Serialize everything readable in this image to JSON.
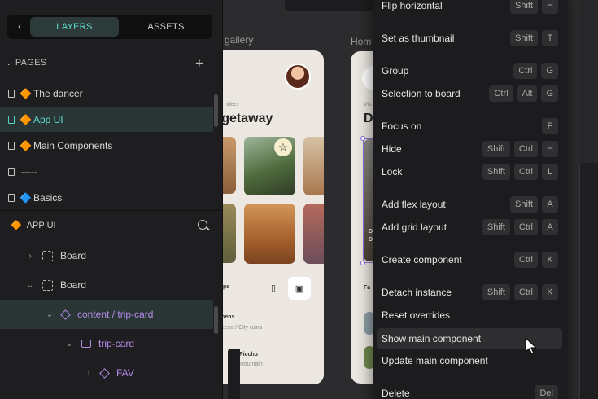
{
  "sidebar": {
    "tabs": {
      "back_icon": "chevron-left-icon",
      "layers": "LAYERS",
      "assets": "ASSETS"
    },
    "pages": {
      "header": "PAGES",
      "items": [
        {
          "label": "The dancer",
          "emoji": "🔶"
        },
        {
          "label": "App UI",
          "emoji": "🔶"
        },
        {
          "label": "Main Components",
          "emoji": "🔶"
        },
        {
          "label": "-----",
          "emoji": ""
        },
        {
          "label": "Basics",
          "emoji": "🔷"
        }
      ]
    },
    "layers": {
      "header": "APP UI",
      "header_emoji": "🔶",
      "items": [
        {
          "label": "Board"
        },
        {
          "label": "Board"
        },
        {
          "label": "content / trip-card"
        },
        {
          "label": "trip-card"
        },
        {
          "label": "FAV"
        }
      ]
    }
  },
  "canvas": {
    "board_labels": [
      "gallery",
      "Hom"
    ],
    "left_phone": {
      "caption": "nders",
      "title": "n getaway",
      "tab_label": "ips",
      "place1_name": "hens",
      "place1_sub": "eece  /  City ruins",
      "place2_name": "Picchu",
      "place2_sub": "Mountain"
    },
    "right_phone": {
      "caption": "Vis",
      "title": "D",
      "card_line1": "D",
      "card_line2": "D",
      "fav_label": "Fa"
    }
  },
  "menu": {
    "items": [
      {
        "label": "Flip horizontal",
        "keys": [
          "Shift",
          "H"
        ]
      },
      {
        "label": "Set as thumbnail",
        "keys": [
          "Shift",
          "T"
        ]
      },
      {
        "label": "Group",
        "keys": [
          "Ctrl",
          "G"
        ]
      },
      {
        "label": "Selection to board",
        "keys": [
          "Ctrl",
          "Alt",
          "G"
        ]
      },
      {
        "label": "Focus on",
        "keys": [
          "F"
        ]
      },
      {
        "label": "Hide",
        "keys": [
          "Shift",
          "Ctrl",
          "H"
        ]
      },
      {
        "label": "Lock",
        "keys": [
          "Shift",
          "Ctrl",
          "L"
        ]
      },
      {
        "label": "Add flex layout",
        "keys": [
          "Shift",
          "A"
        ]
      },
      {
        "label": "Add grid layout",
        "keys": [
          "Shift",
          "Ctrl",
          "A"
        ]
      },
      {
        "label": "Create component",
        "keys": [
          "Ctrl",
          "K"
        ]
      },
      {
        "label": "Detach instance",
        "keys": [
          "Shift",
          "Ctrl",
          "K"
        ]
      },
      {
        "label": "Reset overrides",
        "keys": []
      },
      {
        "label": "Show main component",
        "keys": []
      },
      {
        "label": "Update main component",
        "keys": []
      },
      {
        "label": "Delete",
        "keys": [
          "Del"
        ]
      }
    ]
  },
  "colors": {
    "accent_teal": "#5fe0d0",
    "accent_purple": "#b58de8",
    "sidebar_bg": "#1e1e20",
    "menu_bg": "#1c1c1e"
  }
}
